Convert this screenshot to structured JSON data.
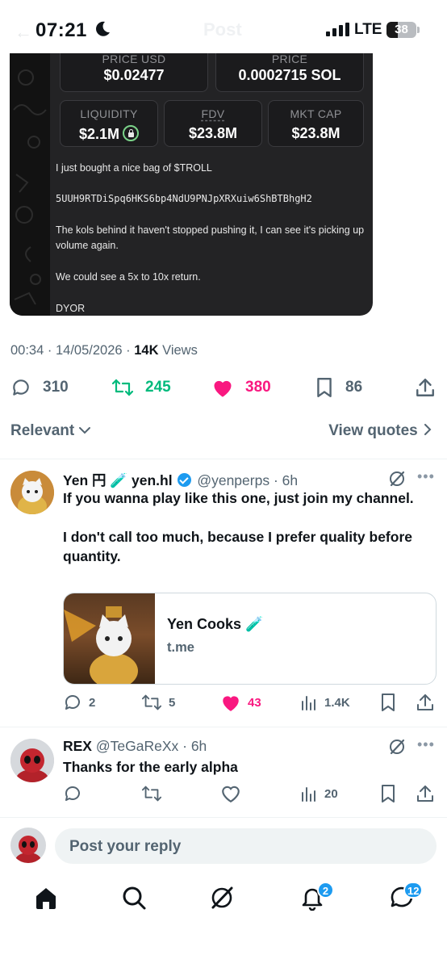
{
  "status_bar": {
    "time": "07:21",
    "network": "LTE",
    "battery": "38",
    "ghost_title": "Post"
  },
  "image_card": {
    "stats_row1": [
      {
        "label": "PRICE USD",
        "value": "$0.02477"
      },
      {
        "label": "PRICE",
        "value": "0.0002715 SOL"
      }
    ],
    "stats_row2": [
      {
        "label": "LIQUIDITY",
        "value": "$2.1M"
      },
      {
        "label": "FDV",
        "value": "$23.8M"
      },
      {
        "label": "MKT CAP",
        "value": "$23.8M"
      }
    ],
    "text_lines": [
      "I just bought a nice bag of $TROLL",
      "5UUH9RTDiSpq6HKS6bp4NdU9PNJpXRXuiw6ShBTBhgH2",
      "The kols behind it haven't stopped pushing it, I can see it's picking up volume again.",
      "We could see a 5x to 10x return.",
      "DYOR"
    ]
  },
  "post_meta": {
    "time": "00:34",
    "date": "14/05/2026",
    "views_count": "14K",
    "views_label": "Views"
  },
  "post_actions": {
    "replies": "310",
    "reposts": "245",
    "likes": "380",
    "bookmarks": "86"
  },
  "sort": {
    "label": "Relevant",
    "view_quotes": "View quotes"
  },
  "replies": [
    {
      "name": "Yen 円 🧪 yen.hl",
      "handle": "@yenperps",
      "time": "6h",
      "text_p1": "If you wanna play like this one, just join my channel.",
      "text_p2": "I don't call too much, because I prefer quality before quantity.",
      "link_title": "Yen Cooks 🧪",
      "link_domain": "t.me",
      "replies": "2",
      "reposts": "5",
      "likes": "43",
      "views": "1.4K"
    },
    {
      "name": "REX",
      "handle": "@TeGaReXx",
      "time": "6h",
      "text": "Thanks for the early alpha",
      "views": "20"
    }
  ],
  "composer": {
    "placeholder": "Post your reply"
  },
  "tabbar": {
    "notifications_badge": "2",
    "messages_badge": "12"
  },
  "colors": {
    "accent": "#1d9bf0",
    "repost_green": "#00ba7c",
    "like_pink": "#f91880",
    "secondary_text": "#536471"
  }
}
